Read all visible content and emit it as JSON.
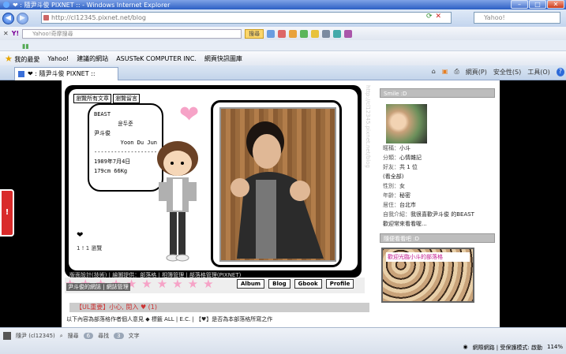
{
  "window": {
    "title": "❤ : 隨尹斗俊 PIXNET :: - Windows Internet Explorer"
  },
  "address": {
    "url": "http://cl12345.pixnet.net/blog",
    "search_placeholder": "Yahoo!"
  },
  "yahoo_toolbar": {
    "logo": "Y!",
    "search_placeholder": "Yahoo!奇摩搜尋",
    "search_button": "搜尋"
  },
  "favorites": {
    "label": "我的最愛",
    "items": [
      "Yahoo!",
      "建議的網站",
      "ASUSTeK COMPUTER INC.",
      "網頁快訊圖庫"
    ]
  },
  "tab": {
    "label": "❤ : 隨尹斗俊 PIXNET ::"
  },
  "commandbar": {
    "page": "網頁(P)",
    "safety": "安全性(S)",
    "tools": "工具(O)",
    "help": "?"
  },
  "header": {
    "tabs": [
      "瀏覽所有文章",
      "瀏覽留言"
    ],
    "bubble": {
      "group": "BEAST",
      "hangul": "윤두준",
      "chinese": "尹斗俊",
      "roman": "Yoon Du Jun",
      "dash": "-------------------",
      "birth": "1989年7月4日",
      "stats": "179cm 66Kg"
    },
    "small_heart": "❤",
    "count": "1 ! 1 瀏覽",
    "footer": "版面設計(技術) | 繪圖提供：部落格 | 相簿管理 | 部落格管理(PIXNET)",
    "vertical_text": "http://cl12345.pixnet.net/blog"
  },
  "nav": {
    "buttons": [
      "Album",
      "Blog",
      "Gbook",
      "Profile"
    ],
    "status": "尹斗俊的網誌 | 網誌管理"
  },
  "section": {
    "title": "【UL重要】小心, 閱入 ♥ (1)"
  },
  "post": {
    "line": "以下內容為部落格作者個人意見 ◆ 標籤 ALL | E.C. | 【♥】是否為本部落格所寫之作"
  },
  "sidebar": {
    "profile_title": "Smile :D",
    "info": [
      {
        "k": "暱稱：",
        "v": "小斗"
      },
      {
        "k": "分類：",
        "v": "心情雜記"
      },
      {
        "k": "好友：",
        "v": "共 1 位"
      },
      {
        "k": "",
        "v": "(看全部)"
      },
      {
        "k": "性別：",
        "v": "女"
      },
      {
        "k": "年齡：",
        "v": "秘密"
      },
      {
        "k": "居住：",
        "v": "台北市"
      },
      {
        "k": "自我介紹：",
        "v": "我很喜歡尹斗俊 的BEAST"
      },
      {
        "k": "",
        "v": "歡迎常來看看喔..."
      }
    ],
    "widget_title": "隨便看看吧 :D",
    "widget_text": "歡迎光臨小斗的部落格"
  },
  "statusbar": {
    "tab_label": "隨尹 (cl12345)",
    "items": [
      "搜尋",
      "尋找",
      "文字"
    ],
    "counts": [
      "6",
      "3"
    ],
    "zone": "網際網路 | 受保護模式: 啟動",
    "zoom": "114%"
  }
}
